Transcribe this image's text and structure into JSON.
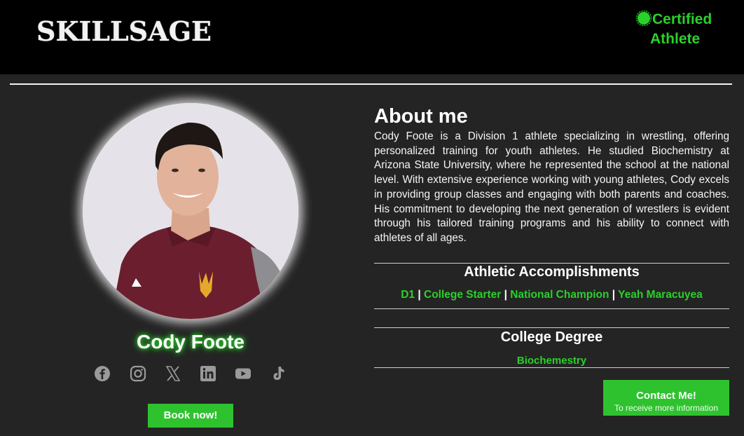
{
  "header": {
    "logo_text": "SKILLSAGE",
    "certified_line1": "Certified",
    "certified_line2": "Athlete"
  },
  "profile": {
    "name": "Cody Foote",
    "book_button": "Book now!",
    "socials": [
      "facebook-icon",
      "instagram-icon",
      "x-icon",
      "linkedin-icon",
      "youtube-icon",
      "tiktok-icon"
    ]
  },
  "about": {
    "title": "About me",
    "body": "Cody Foote is a Division 1 athlete specializing in wrestling, offering personalized training for youth athletes. He studied Biochemistry at Arizona State University, where he represented the school at the national level. With extensive experience working with young athletes, Cody excels in providing group classes and engaging with both parents and coaches. His commitment to developing the next generation of wrestlers is evident through his tailored training programs and his ability to connect with athletes of all ages."
  },
  "accomplishments": {
    "title": "Athletic Accomplishments",
    "items": [
      "D1",
      "College Starter",
      "National Champion",
      "Yeah Maracuyea"
    ],
    "separator": "|"
  },
  "degree": {
    "title": "College Degree",
    "value": "Biochemestry"
  },
  "contact": {
    "label": "Contact Me!",
    "sub": "To receive more information"
  },
  "colors": {
    "accent": "#2ad12a",
    "button": "#2fc22f",
    "background": "#242424",
    "header": "#000000"
  }
}
